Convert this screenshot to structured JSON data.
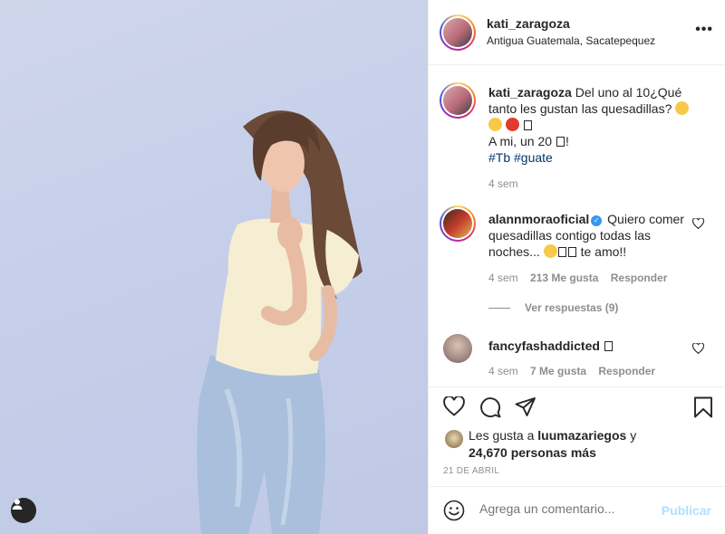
{
  "post": {
    "username": "kati_zaragoza",
    "location": "Antigua Guatemala, Sacatepequez",
    "more_label": "•••"
  },
  "caption": {
    "username": "kati_zaragoza",
    "text_line1": "Del uno al 10¿Qué tanto les gustan las quesadillas?",
    "text_line3": "A mi, un 20",
    "hashtags": [
      "#Tb",
      "#guate"
    ],
    "time": "4 sem"
  },
  "comments": [
    {
      "username": "alannmoraoficial",
      "verified": true,
      "text_a": "Quiero comer quesadillas contigo todas las noches...",
      "text_b": "te amo!!",
      "time": "4 sem",
      "likes": "213 Me gusta",
      "reply": "Responder"
    },
    {
      "username": "fancyfashaddicted",
      "verified": false,
      "time": "4 sem",
      "likes": "7 Me gusta",
      "reply": "Responder"
    }
  ],
  "view_replies": "Ver respuestas (9)",
  "likes": {
    "prefix": "Les gusta a",
    "user": "luumazariegos",
    "joiner": "y",
    "count": "24,670 personas más"
  },
  "date": "21 DE ABRIL",
  "add_comment": {
    "placeholder": "Agrega un comentario...",
    "publish": "Publicar"
  },
  "colors": {
    "hashtag": "#00376b",
    "publish_disabled": "#b2dffc",
    "verified": "#3897f0",
    "muted": "#8e8e8e"
  }
}
